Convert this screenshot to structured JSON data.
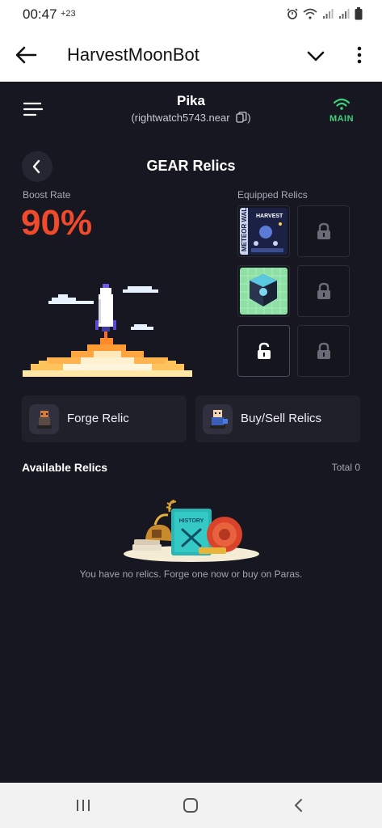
{
  "status_bar": {
    "time": "00:47",
    "extra": "+23",
    "icons": [
      "alarm-icon",
      "wifi-icon",
      "signal-icon",
      "signal-icon",
      "battery-icon"
    ]
  },
  "app_bar": {
    "title": "HarvestMoonBot",
    "icons": [
      "back-arrow-icon",
      "chevron-down-icon",
      "more-vert-icon"
    ]
  },
  "header": {
    "account_name": "Pika",
    "account_id": "(rightwatch5743.near",
    "account_id_close": ")",
    "network_label": "MAIN",
    "network_color": "#3fd07c"
  },
  "page": {
    "title": "GEAR Relics",
    "boost_label": "Boost Rate",
    "boost_value": "90%",
    "boost_color": "#ef4a2c",
    "equipped_label": "Equipped Relics"
  },
  "slots": [
    {
      "state": "filled",
      "relic": "meteor-wallet-harvest-card"
    },
    {
      "state": "locked"
    },
    {
      "state": "filled",
      "relic": "gear-cube"
    },
    {
      "state": "locked"
    },
    {
      "state": "unlocked"
    },
    {
      "state": "locked"
    }
  ],
  "actions": {
    "forge_label": "Forge Relic",
    "buy_sell_label": "Buy/Sell Relics"
  },
  "available": {
    "title": "Available Relics",
    "total": "Total 0",
    "empty_message": "You have no relics. Forge one now or buy on Paras.",
    "book_label": "HISTORY"
  },
  "nav_bar": {
    "icons": [
      "recents-icon",
      "home-icon",
      "back-icon"
    ]
  },
  "card": {
    "top": "HARVEST",
    "side": "METEOR WALLET"
  }
}
